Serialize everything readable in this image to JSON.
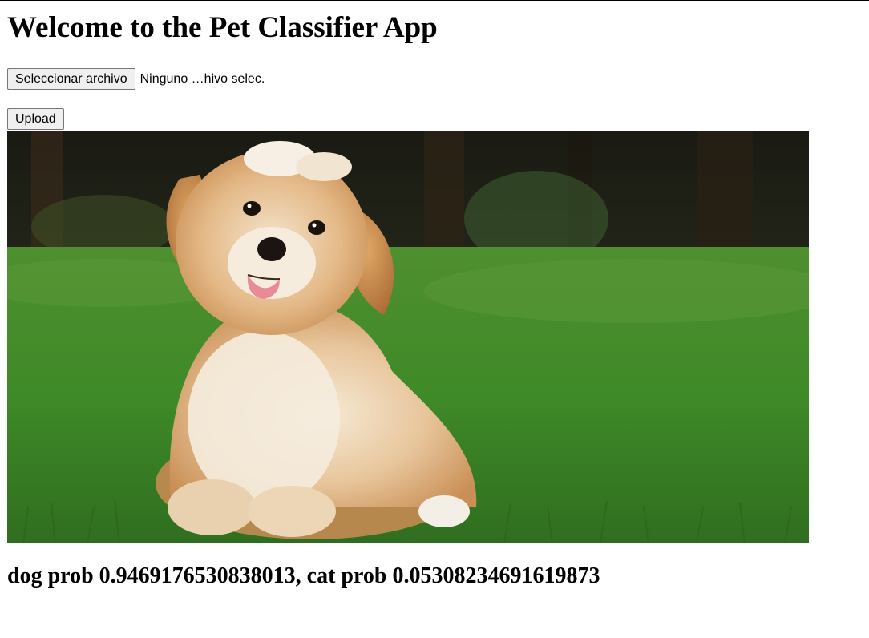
{
  "page": {
    "title": "Welcome to the Pet Classifier App"
  },
  "file_input": {
    "button_label": "Seleccionar archivo",
    "status_text": "Ninguno …hivo selec."
  },
  "upload": {
    "button_label": "Upload"
  },
  "result": {
    "text": "dog prob 0.9469176530838013, cat prob 0.05308234691619873"
  }
}
